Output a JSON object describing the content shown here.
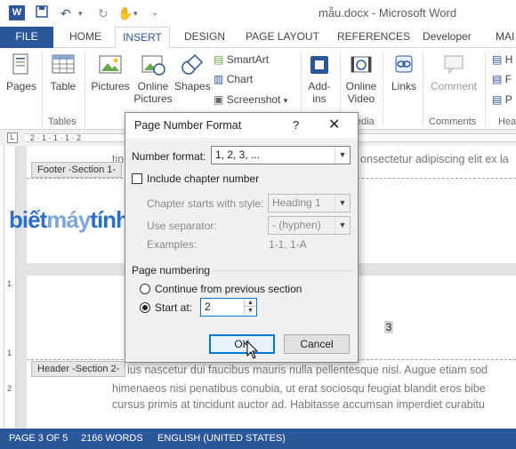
{
  "window": {
    "title": "mẫu.docx - Microsoft Word",
    "app_icon": "W"
  },
  "qat": {
    "icons": [
      "save-icon",
      "undo-icon",
      "redo-icon",
      "touch-mode-icon",
      "customize-qat-icon"
    ]
  },
  "tabs": {
    "file": "FILE",
    "home": "HOME",
    "insert": "INSERT",
    "design": "DESIGN",
    "page_layout": "PAGE LAYOUT",
    "references": "REFERENCES",
    "developer": "Developer",
    "mail": "MAI"
  },
  "ribbon": {
    "pages": "Pages",
    "table": "Table",
    "tables_group": "Tables",
    "pictures": "Pictures",
    "online_pictures_1": "Online",
    "online_pictures_2": "Pictures",
    "shapes": "Shapes",
    "smartart": "SmartArt",
    "chart": "Chart",
    "screenshot": "Screenshot",
    "addins_1": "Add-",
    "addins_2": "ins",
    "online_video_1": "Online",
    "online_video_2": "Video",
    "media_group": "edia",
    "links": "Links",
    "comment": "Comment",
    "comments_group": "Comments",
    "header_h": "H",
    "header_f": "F",
    "header_p": "P",
    "hea_group": "Hea"
  },
  "ruler": {
    "marks": "2 · 1 · 1 · 1 · 2"
  },
  "document": {
    "footer_tag": "Footer -Section 1-",
    "header_tag": "Header -Section 2-",
    "line_top": "tin                                         onsectetur adipiscing elit ex la",
    "line_top_visible": "onsectetur adipiscing elit ex la",
    "line_top_prefix": "tin",
    "line1": "ius nascetur dui faucibus mauris nulla pellentesque nisl. Augue etiam sod",
    "line2": "himenaeos nisi penatibus conubia, ut erat sociosqu feugiat blandit eros bibe",
    "line3": "cursus primis at tincidunt auctor ad. Habitasse accumsan imperdiet curabitu",
    "page_number": "3",
    "watermark_1": "biết",
    "watermark_2": "máy",
    "watermark_3": "tính",
    "vruler_1": "1",
    "vruler_2": "1",
    "vruler_3": "2"
  },
  "dialog": {
    "title": "Page Number Format",
    "help": "?",
    "close": "✕",
    "number_format_label": "Number format:",
    "number_format_value": "1, 2, 3, ...",
    "include_chapter_label": "Include chapter number",
    "include_chapter_checked": false,
    "chapter_style_label": "Chapter starts with style:",
    "chapter_style_value": "Heading 1",
    "separator_label": "Use separator:",
    "separator_value": "-   (hyphen)",
    "examples_label": "Examples:",
    "examples_value": "1-1, 1-A",
    "page_numbering_label": "Page numbering",
    "continue_label": "Continue from previous section",
    "continue_selected": false,
    "start_at_label": "Start at:",
    "start_at_selected": true,
    "start_at_value": "2",
    "ok": "OK",
    "cancel": "Cancel"
  },
  "status": {
    "page": "PAGE 3 OF 5",
    "words": "2166 WORDS",
    "language": "ENGLISH (UNITED STATES)"
  },
  "colors": {
    "accent": "#2b579a",
    "focus": "#0078d7"
  }
}
